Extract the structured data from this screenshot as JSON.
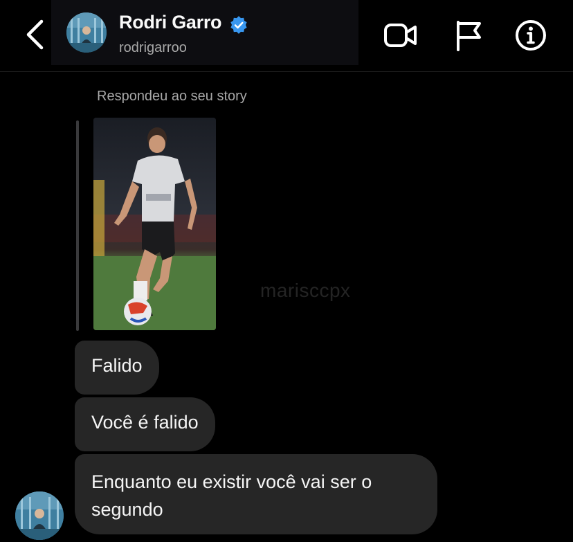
{
  "header": {
    "name": "Rodri Garro",
    "username": "rodrigarroo",
    "verified": true,
    "icons": [
      "back-chevron-icon",
      "video-call-icon",
      "flag-icon",
      "info-icon"
    ]
  },
  "conversation": {
    "story_reply_label": "Respondeu ao seu story",
    "watermark": "marisccpx",
    "messages": [
      {
        "text": "Falido"
      },
      {
        "text": "Você é falido"
      },
      {
        "text": "Enquanto eu existir você vai ser o segundo"
      }
    ]
  },
  "colors": {
    "background": "#000000",
    "bubble": "#262626",
    "verified_badge": "#3897f0",
    "secondary_text": "#a8a8a8"
  }
}
